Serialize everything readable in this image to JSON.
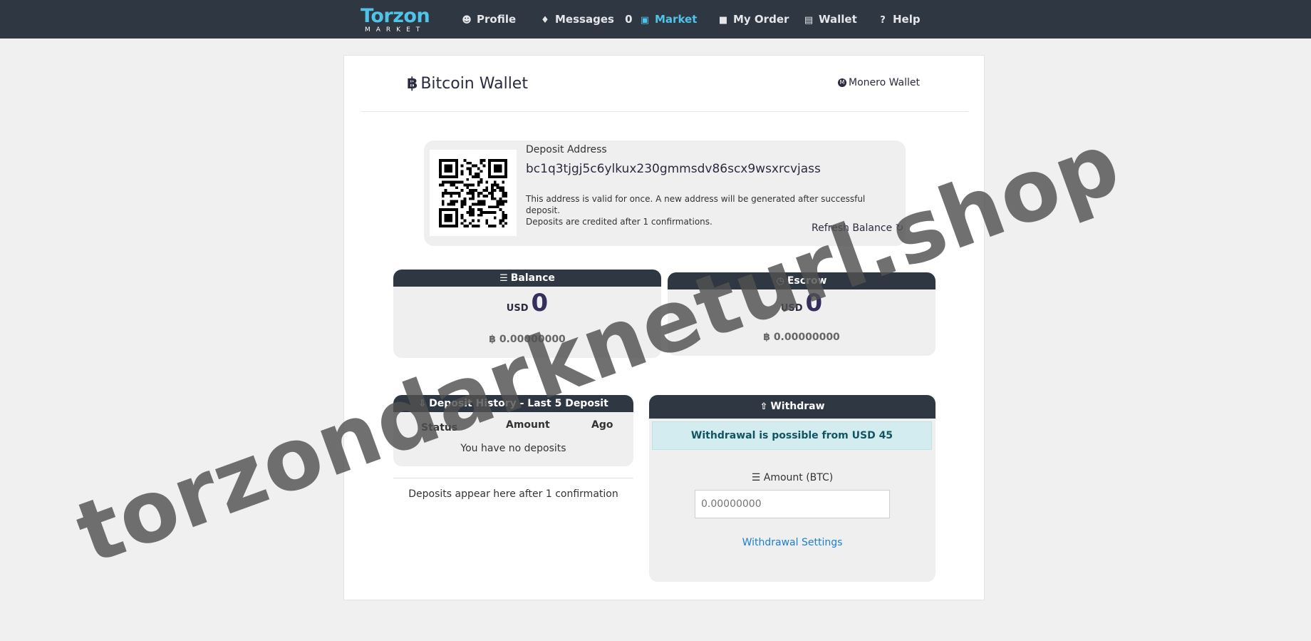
{
  "nav": {
    "logo_word": "Torzon",
    "logo_sub": "MARKET",
    "items": [
      {
        "label": "Profile",
        "icon": "user-icon"
      },
      {
        "label": "Messages",
        "count": "0",
        "icon": "bell-icon"
      },
      {
        "label": "Market",
        "icon": "store-icon",
        "active": true
      },
      {
        "label": "My Order",
        "icon": "bag-icon"
      },
      {
        "label": "Wallet",
        "icon": "wallet-icon"
      },
      {
        "label": "Help",
        "icon": "question-icon"
      }
    ]
  },
  "wallet": {
    "title": "Bitcoin Wallet",
    "other_wallet": "Monero Wallet"
  },
  "deposit": {
    "label": "Deposit Address",
    "address": "bc1q3tjgj5c6ylkux230gmmsdv86scx9wsxrcvjass",
    "note_line1": "This address is valid for once. A new address will be generated after successful deposit.",
    "note_line2": "Deposits are credited after 1 confirmations.",
    "refresh": "Refresh Balance ↻"
  },
  "balance": {
    "title": "Balance",
    "usd_label": "USD",
    "usd_value": "0",
    "btc_value": "0.00000000"
  },
  "escrow": {
    "title": "Escrow",
    "usd_label": "USD",
    "usd_value": "0",
    "btc_value": "0.00000000"
  },
  "history": {
    "title": "Deposit History - Last 5 Deposit",
    "columns": [
      "Status",
      "Amount",
      "Ago"
    ],
    "empty": "You have no deposits",
    "footer": "Deposits appear here after 1 confirmation"
  },
  "withdraw": {
    "title": "Withdraw",
    "alert": "Withdrawal is possible from USD 45",
    "amount_label": "Amount (BTC)",
    "amount_placeholder": "0.00000000",
    "settings_link": "Withdrawal Settings"
  },
  "watermark": "torzondarkneturl.shop",
  "colors": {
    "nav_bg": "#2f3742",
    "accent": "#4fc3e8",
    "link": "#1a7fd4",
    "alert_bg": "#d2ecef"
  }
}
